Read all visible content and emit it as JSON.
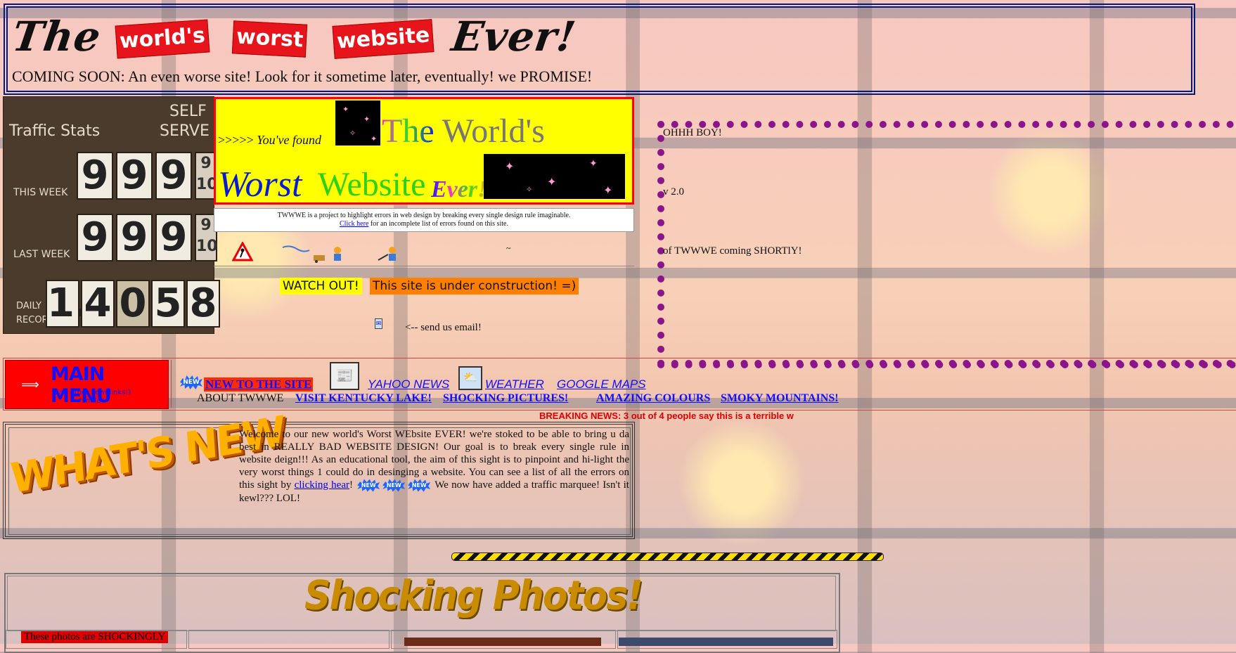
{
  "header": {
    "title_the": "The",
    "title_worlds": "world's",
    "title_worst": "worst",
    "title_website": "website",
    "title_ever": "Ever!",
    "coming_soon": "COMING SOON: An even worse site! Look for it sometime later, eventually!  we PROMISE!"
  },
  "traffic": {
    "label": "Traffic Stats",
    "self_serve_1": "SELF",
    "self_serve_2": "SERVE",
    "this_week_label": "THIS WEEK",
    "last_week_label": "LAST WEEK",
    "daily_label_1": "DAILY",
    "daily_label_2": "RECOR",
    "this_week_digits": [
      "9",
      "9",
      "9"
    ],
    "last_week_digits": [
      "9",
      "9",
      "9"
    ],
    "fraction_top": "9",
    "fraction_bottom": "10",
    "daily_digits": [
      "1.",
      "4",
      "0",
      "5",
      "8"
    ]
  },
  "found": {
    "arrows": ">>>>>",
    "youve_found": "You've found",
    "the": "The",
    "worlds": "World's",
    "worst": "Worst",
    "website": "Website",
    "ever": "Ever!"
  },
  "description": {
    "line1": "TWWWE is a project to highlight errors in web design by breaking every single design rule imaginable.",
    "link": "Click here",
    "line2": "for an incomplete list of errors found on this site."
  },
  "construction": {
    "watch_out": "WATCH OUT!",
    "under_construction": "This site is under construction! =)",
    "email_text": "<-- send us email!"
  },
  "dotbox": {
    "ohhh": "OHHH BOY!",
    "version": "v 2.0",
    "coming": "of TWWWE coming SHORTlY!"
  },
  "menu": {
    "main_menu": "MAIN MENU",
    "sub_1": "(and other kewl links!)",
    "sub_2": "*smile*",
    "new_badge": "NEW",
    "new_to_site": "NEW TO THE SITE",
    "yahoo_news": "YAHOO NEWS",
    "weather": "WEATHER",
    "google_maps": "GOOGLE MAPS",
    "about": "ABOUT TWWWE",
    "kentucky": "VISIT KENTUCKY LAKE!",
    "shocking": "SHOCKING PICTURES!",
    "colours": "AMAZING COLOURS",
    "smoky": "SMOKY MOUNTAINS!",
    "breaking": "BREAKING NEWS:  3 out of 4 people say this is a terrible w"
  },
  "whats_new": {
    "art_text": "WHAT'S NEW",
    "p1": "Welcome to our new world's Worst WEbsite EVER!  we're stoked to be able to bring u da best in REALLY BAD WEBSITE DESIGN!  Our goal is to break every single rule in website deign!!!     As an educational tool, the aim of this sight is to pinpoint and hi-light the very worst things 1 could do in desinging a website.  You can see a list of all the errors on this sight by",
    "link": "clicking hear",
    "p2_pre": "!",
    "p2": "We now have added a traffic marquee!  Isn't it kewl??? LOL!"
  },
  "photos": {
    "title": "Shocking Photos!",
    "note": "These photos are SHOCKINGLY"
  },
  "colors": {
    "accent_red": "#ff0000",
    "link_blue": "#1010ff",
    "dot_purple": "#8b158b",
    "highlight_yellow": "#ffff00",
    "under_construction_orange": "#ff7f00"
  },
  "icons": [
    "construction-sign-icon",
    "workers-icon",
    "newspaper-icon",
    "weather-icon",
    "email-icon",
    "new-badge-icon",
    "arrow-icon",
    "caution-tape-icon"
  ]
}
